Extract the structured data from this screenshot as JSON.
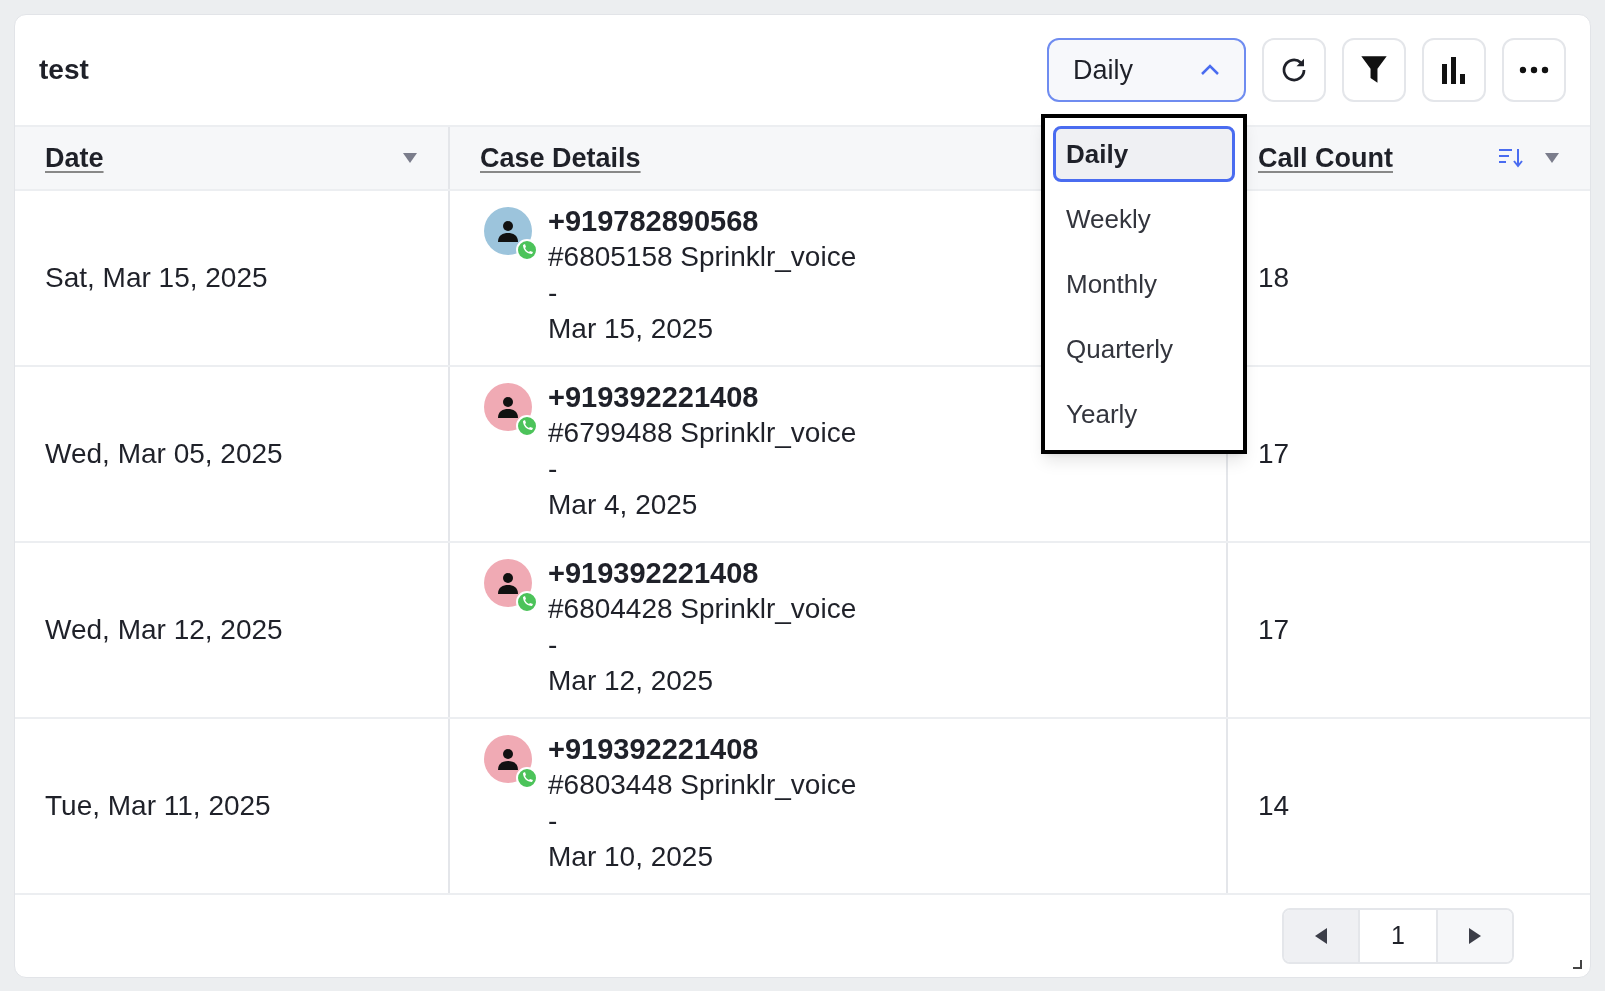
{
  "widget": {
    "title": "test",
    "period_select": {
      "value": "Daily",
      "expanded": true
    },
    "period_menu": [
      {
        "label": "Daily",
        "selected": true
      },
      {
        "label": "Weekly",
        "selected": false
      },
      {
        "label": "Monthly",
        "selected": false
      },
      {
        "label": "Quarterly",
        "selected": false
      },
      {
        "label": "Yearly",
        "selected": false
      }
    ],
    "table": {
      "columns": [
        {
          "label": "Date",
          "sortable": false
        },
        {
          "label": "Case Details",
          "sortable": false
        },
        {
          "label": "Call Count",
          "sortable": true
        }
      ],
      "rows": [
        {
          "date": "Sat, Mar 15, 2025",
          "phone": "+919782890568",
          "case": "#6805158 Sprinklr_voice",
          "separator": "-",
          "case_date": "Mar 15, 2025",
          "call_count": "18",
          "color": "#9cc4dc"
        },
        {
          "date": "Wed, Mar 05, 2025",
          "phone": "+919392221408",
          "case": "#6799488 Sprinklr_voice",
          "separator": "-",
          "case_date": "Mar 4, 2025",
          "call_count": "17",
          "color": "#f0aab4"
        },
        {
          "date": "Wed, Mar 12, 2025",
          "phone": "+919392221408",
          "case": "#6804428 Sprinklr_voice",
          "separator": "-",
          "case_date": "Mar 12, 2025",
          "call_count": "17",
          "color": "#f0aab4"
        },
        {
          "date": "Tue, Mar 11, 2025",
          "phone": "+919392221408",
          "case": "#6803448 Sprinklr_voice",
          "separator": "-",
          "case_date": "Mar 10, 2025",
          "call_count": "14",
          "color": "#f0aab4"
        }
      ]
    },
    "pagination": {
      "page": "1"
    }
  }
}
